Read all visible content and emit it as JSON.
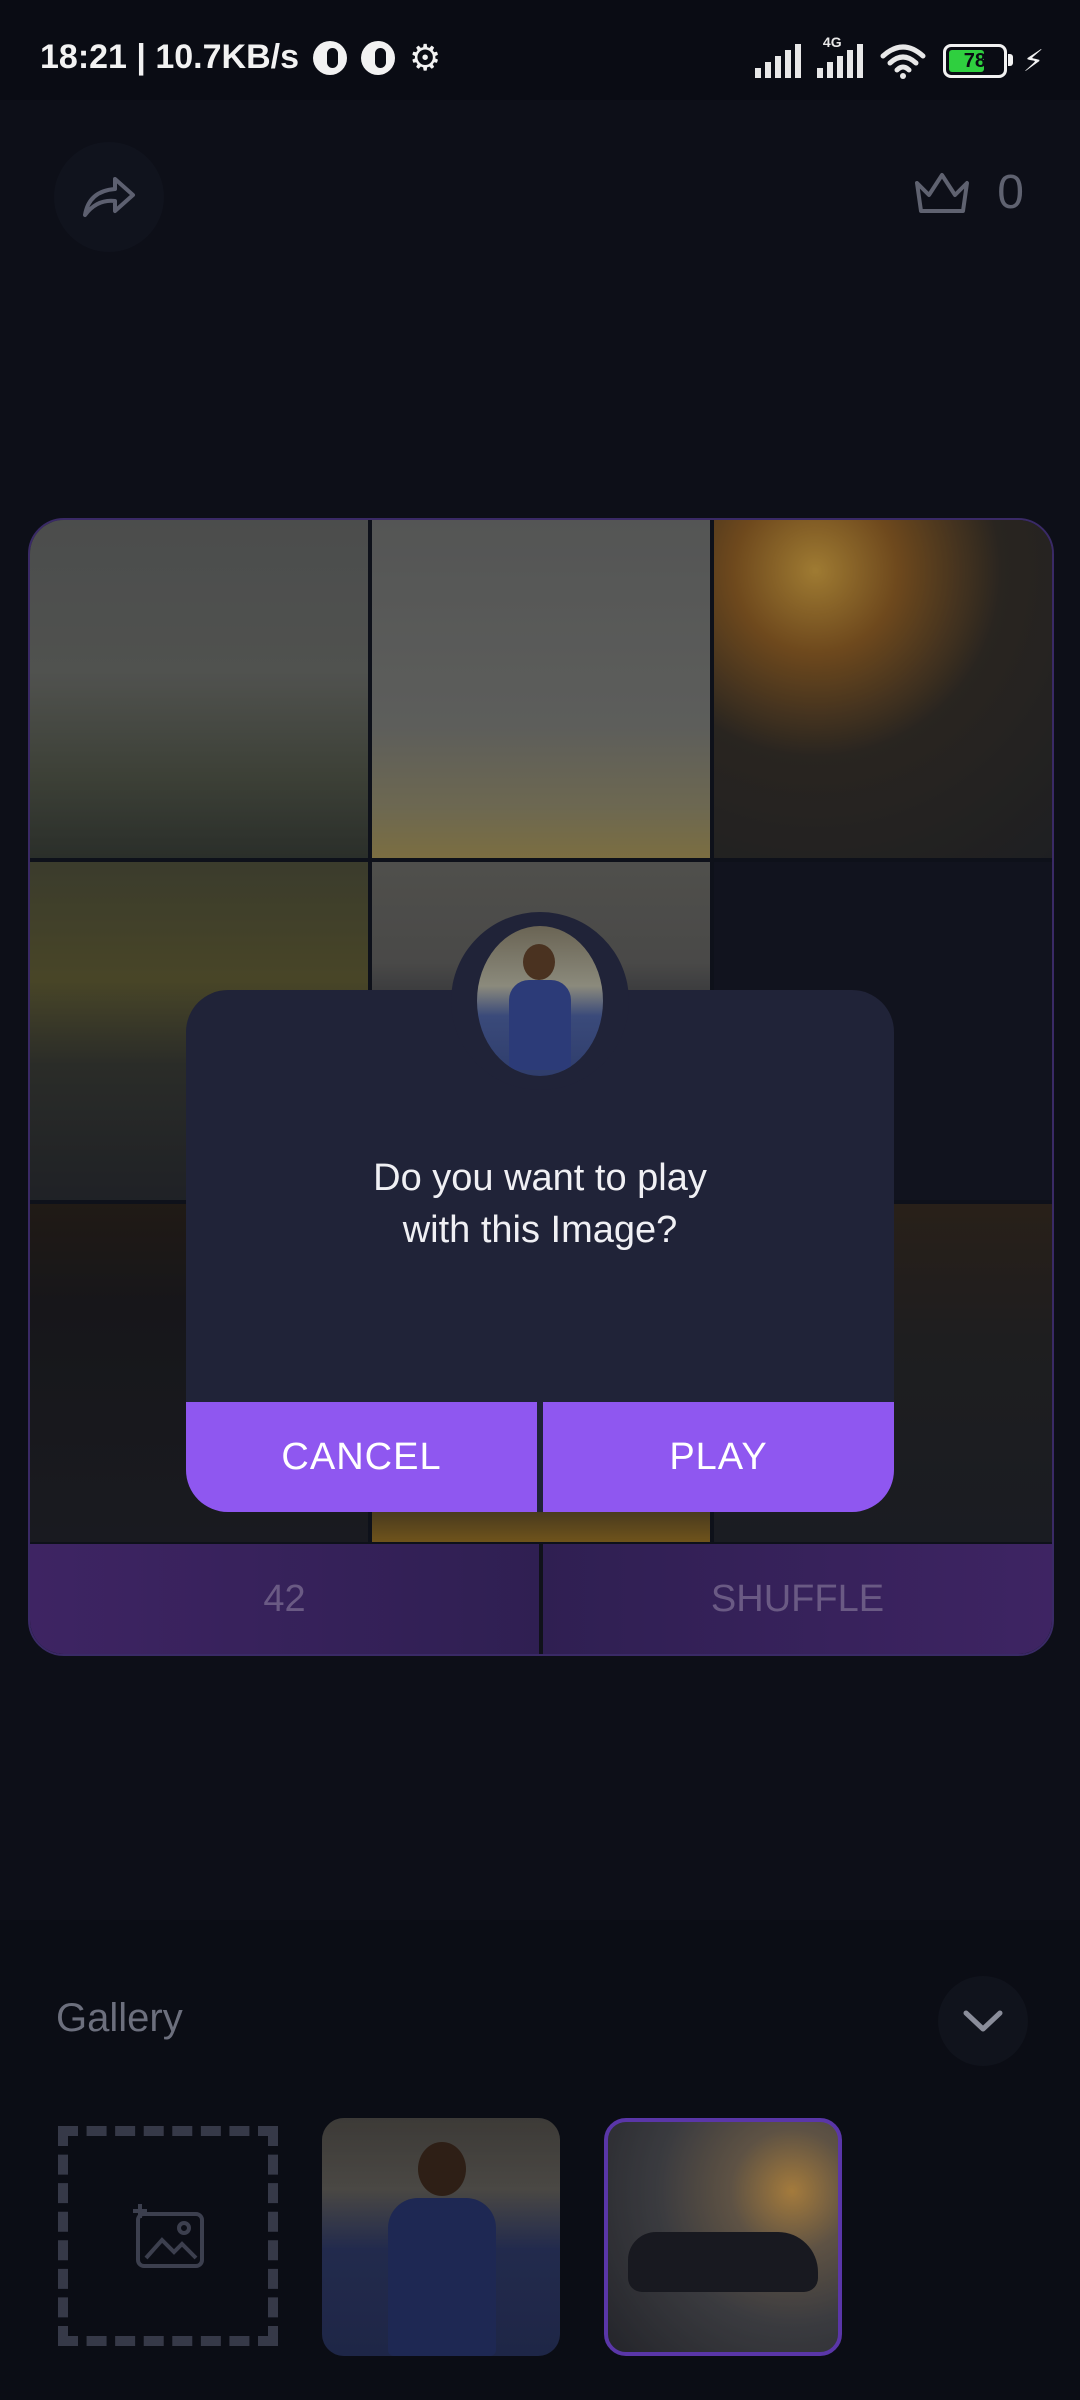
{
  "status_bar": {
    "time_speed": "18:21 | 10.7KB/s",
    "network_type": "4G",
    "battery": "78"
  },
  "header": {
    "share_icon": "share-icon",
    "crown_icon": "crown-icon",
    "score": "0"
  },
  "board": {
    "moves": "42",
    "shuffle_label": "SHUFFLE"
  },
  "dialog": {
    "line1": "Do you want to play",
    "line2": "with this Image?",
    "cancel_label": "CANCEL",
    "play_label": "PLAY"
  },
  "gallery": {
    "title": "Gallery",
    "add_icon": "add-image-icon",
    "collapse_icon": "chevron-down-icon"
  },
  "colors": {
    "accent": "#8f57f0",
    "dialog_bg": "#202338",
    "page_bg": "#0d0f18"
  }
}
